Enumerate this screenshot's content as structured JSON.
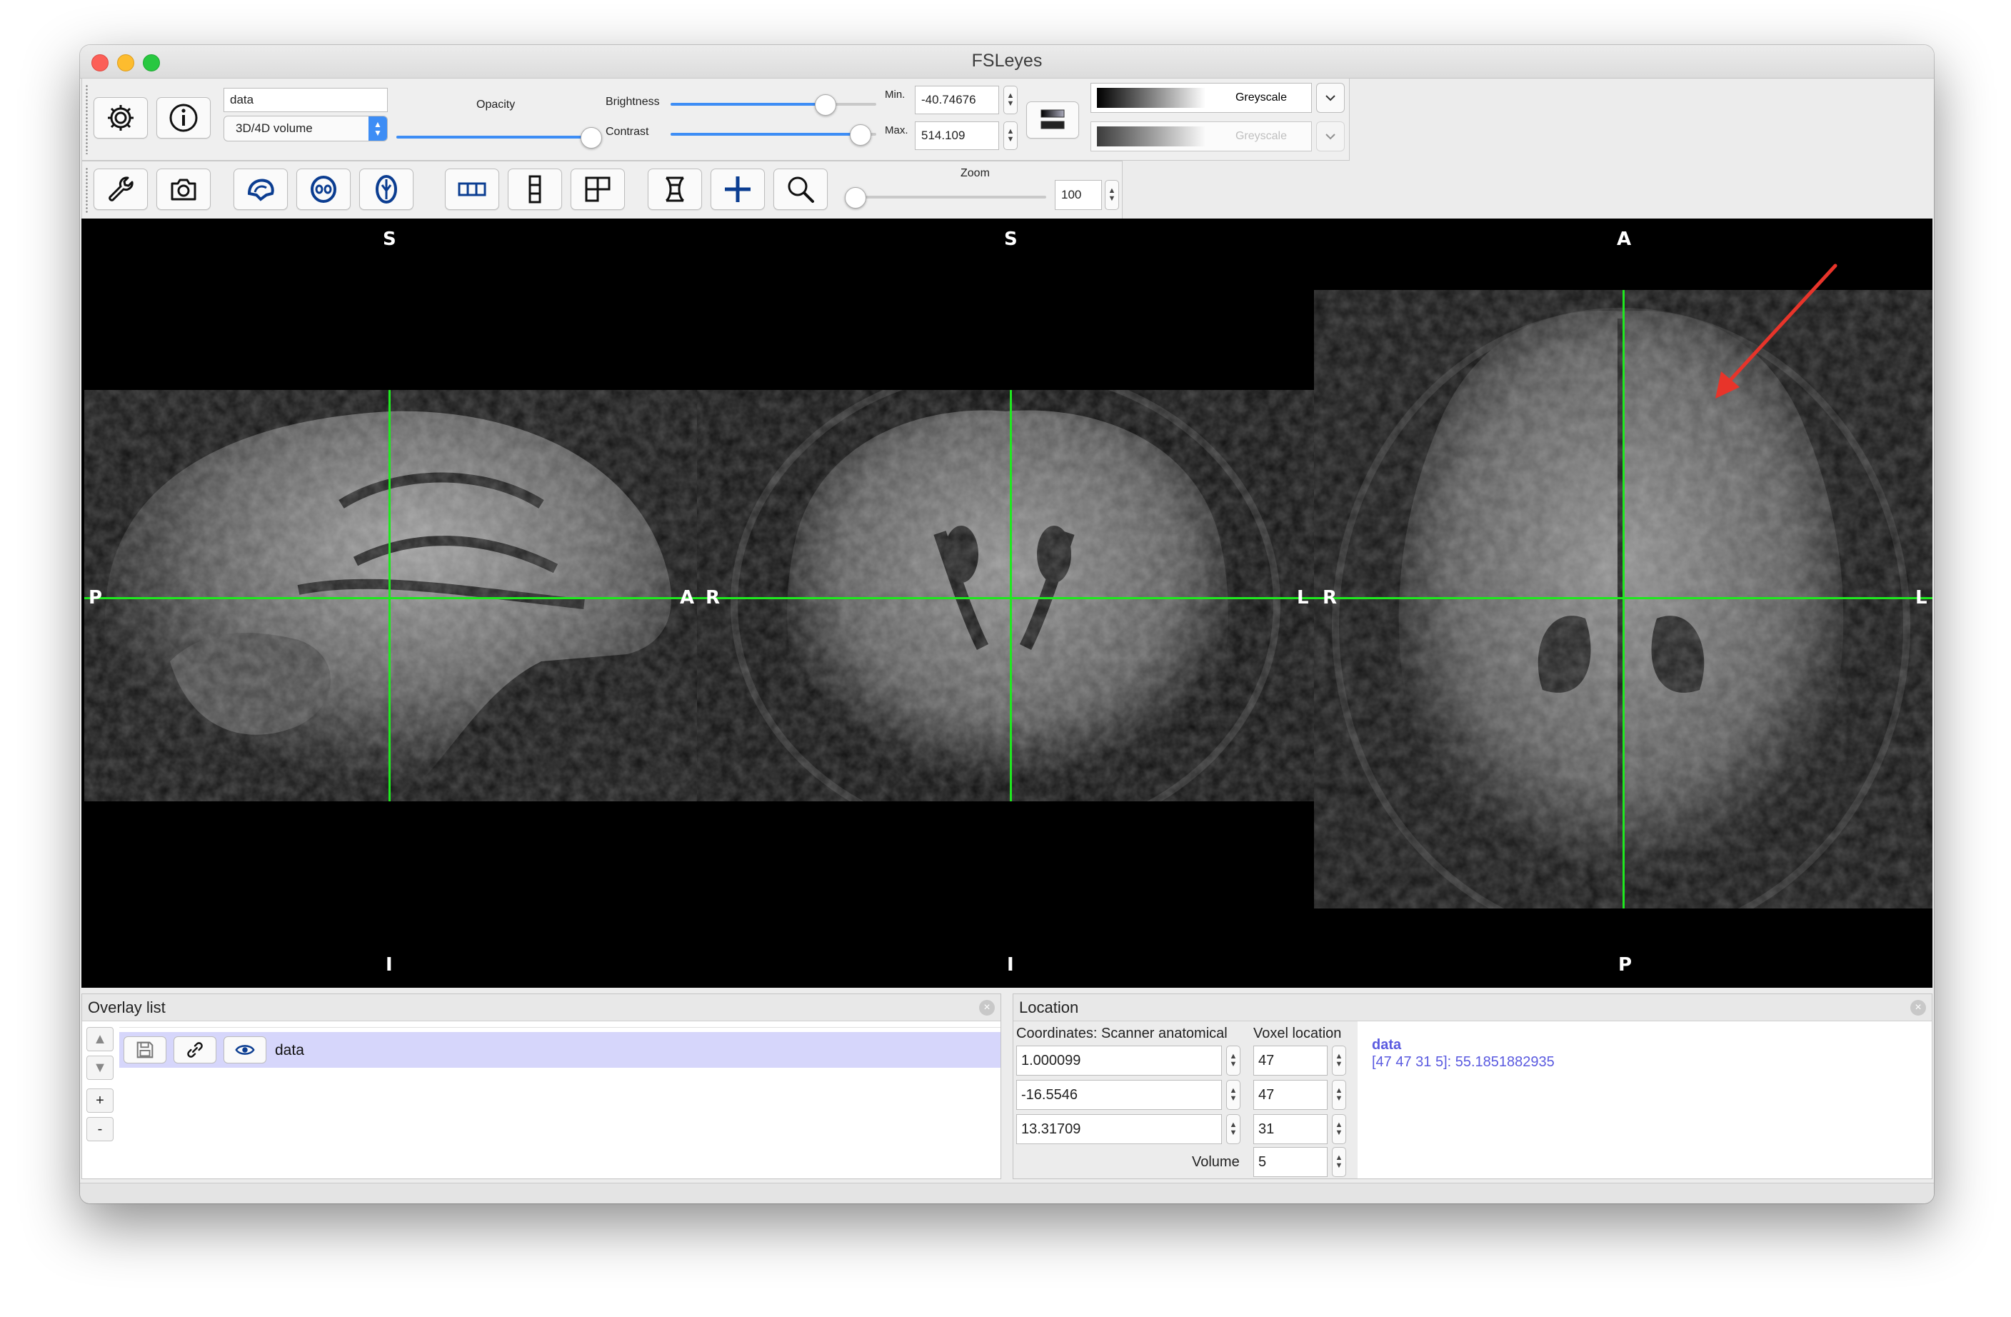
{
  "window": {
    "title": "FSLeyes"
  },
  "toolbar1": {
    "overlay_name": "data",
    "overlay_type": "3D/4D volume",
    "opacity_label": "Opacity",
    "brightness_label": "Brightness",
    "contrast_label": "Contrast",
    "min_label": "Min.",
    "max_label": "Max.",
    "min_value": "-40.74676",
    "max_value": "514.109",
    "colormap": "Greyscale",
    "neg_colormap": "Greyscale",
    "opacity_level": 1.0,
    "brightness_level": 0.75,
    "contrast_level": 0.92
  },
  "toolbar2": {
    "zoom_label": "Zoom",
    "zoom_value": "100",
    "zoom_level": 0.0
  },
  "views": {
    "sagittal": {
      "top": "S",
      "bottom": "I",
      "left": "P",
      "right": "A"
    },
    "coronal": {
      "top": "S",
      "bottom": "I",
      "left": "R",
      "right": "L"
    },
    "axial": {
      "top": "A",
      "bottom": "P",
      "left": "R",
      "right": "L"
    }
  },
  "overlay_list": {
    "title": "Overlay list",
    "items": [
      {
        "name": "data"
      }
    ],
    "up": "▲",
    "down": "▼",
    "add": "+",
    "remove": "-"
  },
  "location": {
    "title": "Location",
    "coord_label": "Coordinates: Scanner anatomical",
    "voxel_label": "Voxel location",
    "coords": [
      "1.000099",
      "-16.5546",
      "13.31709"
    ],
    "voxels": [
      "47",
      "47",
      "31"
    ],
    "volume_label": "Volume",
    "volume": "5",
    "info_name": "data",
    "info_value": "[47 47 31 5]: 55.1851882935"
  },
  "colors": {
    "accent": "#3d8df5",
    "crosshair": "#1fe81f",
    "selection": "#d6d6fb",
    "info_text": "#5a5ae0",
    "annotation_arrow": "#e8342a"
  }
}
